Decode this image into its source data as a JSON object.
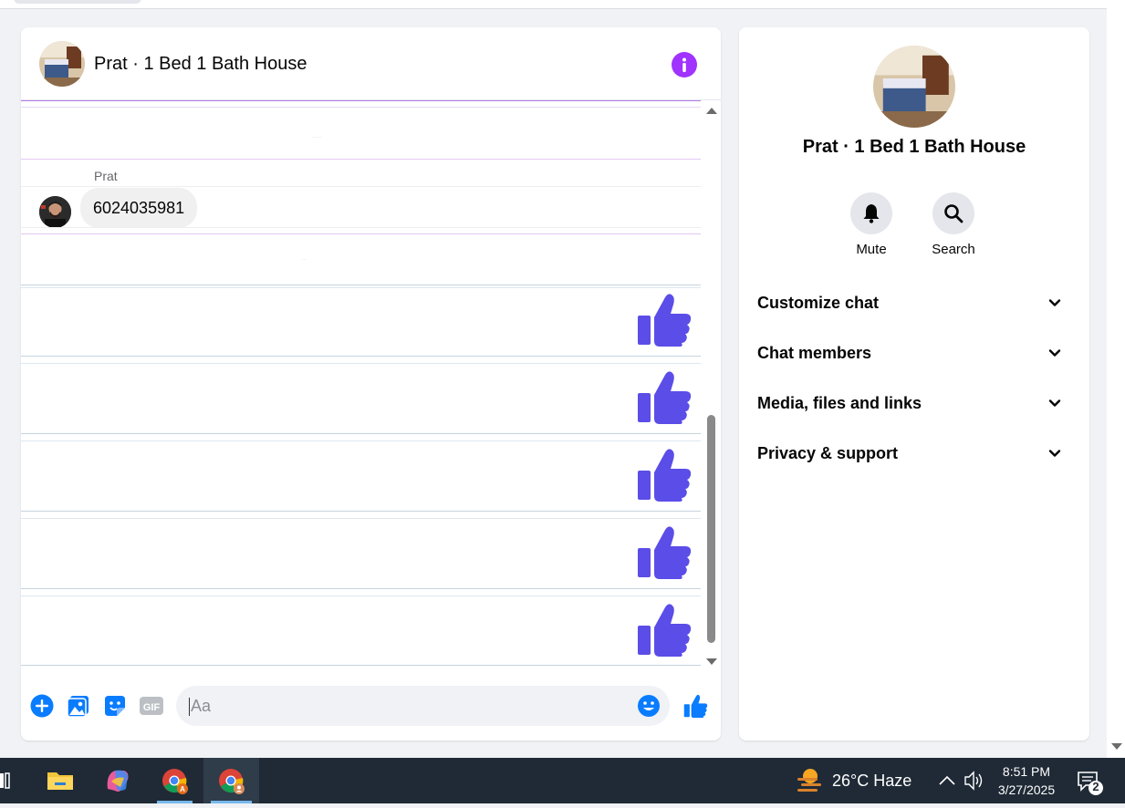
{
  "chat": {
    "title": "Prat · 1 Bed 1 Bath House",
    "sender_name": "Prat",
    "message_text": "6024035981",
    "like_count": 5,
    "composer": {
      "placeholder": "Aa"
    }
  },
  "info_panel": {
    "title": "Prat · 1 Bed 1 Bath House",
    "actions": [
      {
        "label": "Mute",
        "icon": "bell-icon"
      },
      {
        "label": "Search",
        "icon": "search-icon"
      }
    ],
    "sections": [
      {
        "label": "Customize chat"
      },
      {
        "label": "Chat members"
      },
      {
        "label": "Media, files and links"
      },
      {
        "label": "Privacy & support"
      }
    ]
  },
  "taskbar": {
    "weather": "26°C  Haze",
    "time": "8:51 PM",
    "date": "3/27/2025",
    "notification_count": "2"
  },
  "colors": {
    "accent_purple": "#a033ff",
    "like_blue": "#5b4de8",
    "messenger_blue": "#0a7cff"
  }
}
